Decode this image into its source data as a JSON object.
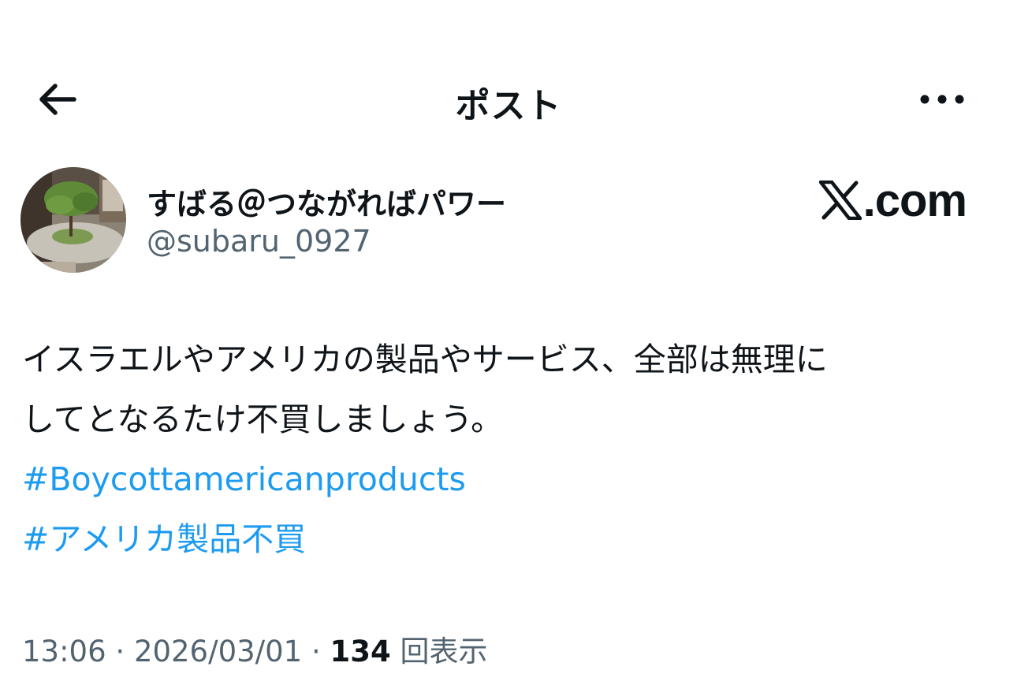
{
  "header": {
    "title": "ポスト",
    "back_icon": "arrow-left-icon",
    "more_icon": "more-horizontal-icon"
  },
  "author": {
    "display_name": "すばる＠つながればパワー",
    "handle": "@subaru_0927",
    "avatar_icon": "avatar-garden-photo"
  },
  "watermark": {
    "text": ".com"
  },
  "post": {
    "text": "イスラエルやアメリカの製品やサービス、全部は無理に\nしてとなるたけ不買しましょう。",
    "hashtags": [
      "#Boycottamericanproducts",
      "#アメリカ製品不買"
    ]
  },
  "meta": {
    "time": "13:06",
    "separator": " · ",
    "date": "2026/03/01",
    "views_count": "134",
    "views_label": " 回表示"
  },
  "colors": {
    "link": "#1d9bf0",
    "secondary_text": "#536471",
    "primary_text": "#0f1419"
  }
}
